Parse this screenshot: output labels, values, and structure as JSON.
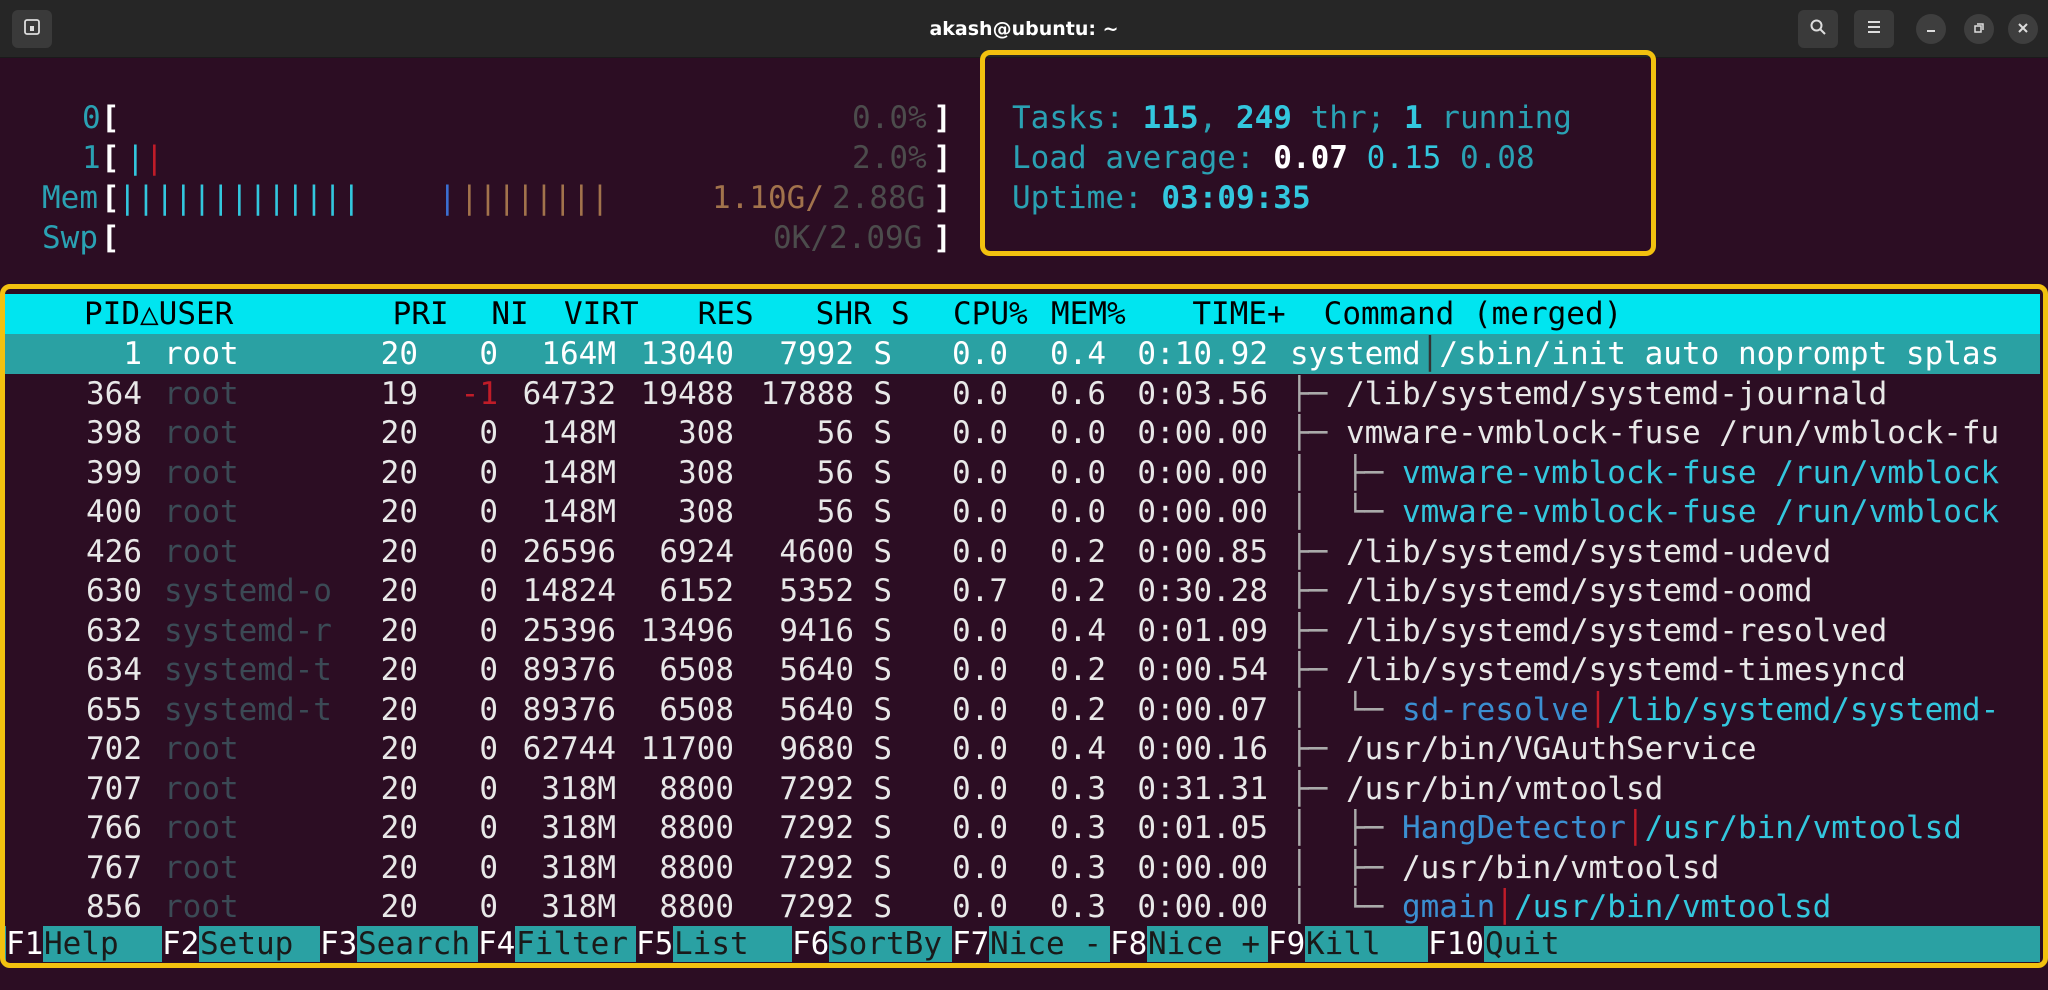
{
  "window": {
    "title": "akash@ubuntu: ~"
  },
  "meters": {
    "cpu0": {
      "label": "0",
      "value": "0.0%"
    },
    "cpu1": {
      "label": "1",
      "value": "2.0%"
    },
    "mem": {
      "label": "Mem",
      "used": "1.10G",
      "total": "2.88G"
    },
    "swp": {
      "label": "Swp",
      "value": "0K/2.09G"
    }
  },
  "summary": {
    "tasks_label": "Tasks: ",
    "tasks": "115",
    "thr": "249",
    "thr_label": " thr; ",
    "running": "1",
    "running_label": " running",
    "load_label": "Load average: ",
    "load1": "0.07",
    "load5": "0.15",
    "load15": "0.08",
    "uptime_label": "Uptime: ",
    "uptime": "03:09:35"
  },
  "columns": [
    "PID",
    "USER",
    "PRI",
    "NI",
    "VIRT",
    "RES",
    "SHR",
    "S",
    "CPU%",
    "MEM%",
    "TIME+",
    "Command (merged)"
  ],
  "processes": [
    {
      "pid": "1",
      "user": "root",
      "pri": "20",
      "ni": "0",
      "virt": "164M",
      "res": "13040",
      "shr": "7992",
      "s": "S",
      "cpu": "0.0",
      "mem": "0.4",
      "time": "0:10.92",
      "cmd": "systemd",
      "args": "/sbin/init auto noprompt splas"
    },
    {
      "pid": "364",
      "user": "root",
      "pri": "19",
      "ni": "-1",
      "virt": "64732",
      "res": "19488",
      "shr": "17888",
      "s": "S",
      "cpu": "0.0",
      "mem": "0.6",
      "time": "0:03.56",
      "cmd": "/lib/systemd/systemd-journald"
    },
    {
      "pid": "398",
      "user": "root",
      "pri": "20",
      "ni": "0",
      "virt": "148M",
      "res": "308",
      "shr": "56",
      "s": "S",
      "cpu": "0.0",
      "mem": "0.0",
      "time": "0:00.00",
      "cmd": "vmware-vmblock-fuse /run/vmblock-fu"
    },
    {
      "pid": "399",
      "user": "root",
      "pri": "20",
      "ni": "0",
      "virt": "148M",
      "res": "308",
      "shr": "56",
      "s": "S",
      "cpu": "0.0",
      "mem": "0.0",
      "time": "0:00.00",
      "cmd": "vmware-vmblock-fuse /run/vmblock"
    },
    {
      "pid": "400",
      "user": "root",
      "pri": "20",
      "ni": "0",
      "virt": "148M",
      "res": "308",
      "shr": "56",
      "s": "S",
      "cpu": "0.0",
      "mem": "0.0",
      "time": "0:00.00",
      "cmd": "vmware-vmblock-fuse /run/vmblock"
    },
    {
      "pid": "426",
      "user": "root",
      "pri": "20",
      "ni": "0",
      "virt": "26596",
      "res": "6924",
      "shr": "4600",
      "s": "S",
      "cpu": "0.0",
      "mem": "0.2",
      "time": "0:00.85",
      "cmd": "/lib/systemd/systemd-udevd"
    },
    {
      "pid": "630",
      "user": "systemd-o",
      "pri": "20",
      "ni": "0",
      "virt": "14824",
      "res": "6152",
      "shr": "5352",
      "s": "S",
      "cpu": "0.7",
      "mem": "0.2",
      "time": "0:30.28",
      "cmd": "/lib/systemd/systemd-oomd"
    },
    {
      "pid": "632",
      "user": "systemd-r",
      "pri": "20",
      "ni": "0",
      "virt": "25396",
      "res": "13496",
      "shr": "9416",
      "s": "S",
      "cpu": "0.0",
      "mem": "0.4",
      "time": "0:01.09",
      "cmd": "/lib/systemd/systemd-resolved"
    },
    {
      "pid": "634",
      "user": "systemd-t",
      "pri": "20",
      "ni": "0",
      "virt": "89376",
      "res": "6508",
      "shr": "5640",
      "s": "S",
      "cpu": "0.0",
      "mem": "0.2",
      "time": "0:00.54",
      "cmd": "/lib/systemd/systemd-timesyncd"
    },
    {
      "pid": "655",
      "user": "systemd-t",
      "pri": "20",
      "ni": "0",
      "virt": "89376",
      "res": "6508",
      "shr": "5640",
      "s": "S",
      "cpu": "0.0",
      "mem": "0.2",
      "time": "0:00.07",
      "cmd": "sd-resolve",
      "args": "/lib/systemd/systemd-"
    },
    {
      "pid": "702",
      "user": "root",
      "pri": "20",
      "ni": "0",
      "virt": "62744",
      "res": "11700",
      "shr": "9680",
      "s": "S",
      "cpu": "0.0",
      "mem": "0.4",
      "time": "0:00.16",
      "cmd": "/usr/bin/VGAuthService"
    },
    {
      "pid": "707",
      "user": "root",
      "pri": "20",
      "ni": "0",
      "virt": "318M",
      "res": "8800",
      "shr": "7292",
      "s": "S",
      "cpu": "0.0",
      "mem": "0.3",
      "time": "0:31.31",
      "cmd": "/usr/bin/vmtoolsd"
    },
    {
      "pid": "766",
      "user": "root",
      "pri": "20",
      "ni": "0",
      "virt": "318M",
      "res": "8800",
      "shr": "7292",
      "s": "S",
      "cpu": "0.0",
      "mem": "0.3",
      "time": "0:01.05",
      "cmd": "HangDetector",
      "args": "/usr/bin/vmtoolsd"
    },
    {
      "pid": "767",
      "user": "root",
      "pri": "20",
      "ni": "0",
      "virt": "318M",
      "res": "8800",
      "shr": "7292",
      "s": "S",
      "cpu": "0.0",
      "mem": "0.3",
      "time": "0:00.00",
      "cmd": "/usr/bin/vmtoolsd"
    },
    {
      "pid": "856",
      "user": "root",
      "pri": "20",
      "ni": "0",
      "virt": "318M",
      "res": "8800",
      "shr": "7292",
      "s": "S",
      "cpu": "0.0",
      "mem": "0.3",
      "time": "0:00.00",
      "cmd": "gmain",
      "args": "/usr/bin/vmtoolsd"
    }
  ],
  "footer": [
    {
      "key": "F1",
      "label": "Help"
    },
    {
      "key": "F2",
      "label": "Setup"
    },
    {
      "key": "F3",
      "label": "Search"
    },
    {
      "key": "F4",
      "label": "Filter"
    },
    {
      "key": "F5",
      "label": "List"
    },
    {
      "key": "F6",
      "label": "SortBy"
    },
    {
      "key": "F7",
      "label": "Nice -"
    },
    {
      "key": "F8",
      "label": "Nice +"
    },
    {
      "key": "F9",
      "label": "Kill"
    },
    {
      "key": "F10",
      "label": "Quit"
    }
  ],
  "colors": {
    "terminal_bg": "#2c0d23",
    "highlight": "#f2c10f",
    "header_bg": "#00e5f0",
    "selection_bg": "#2aa1a3"
  }
}
